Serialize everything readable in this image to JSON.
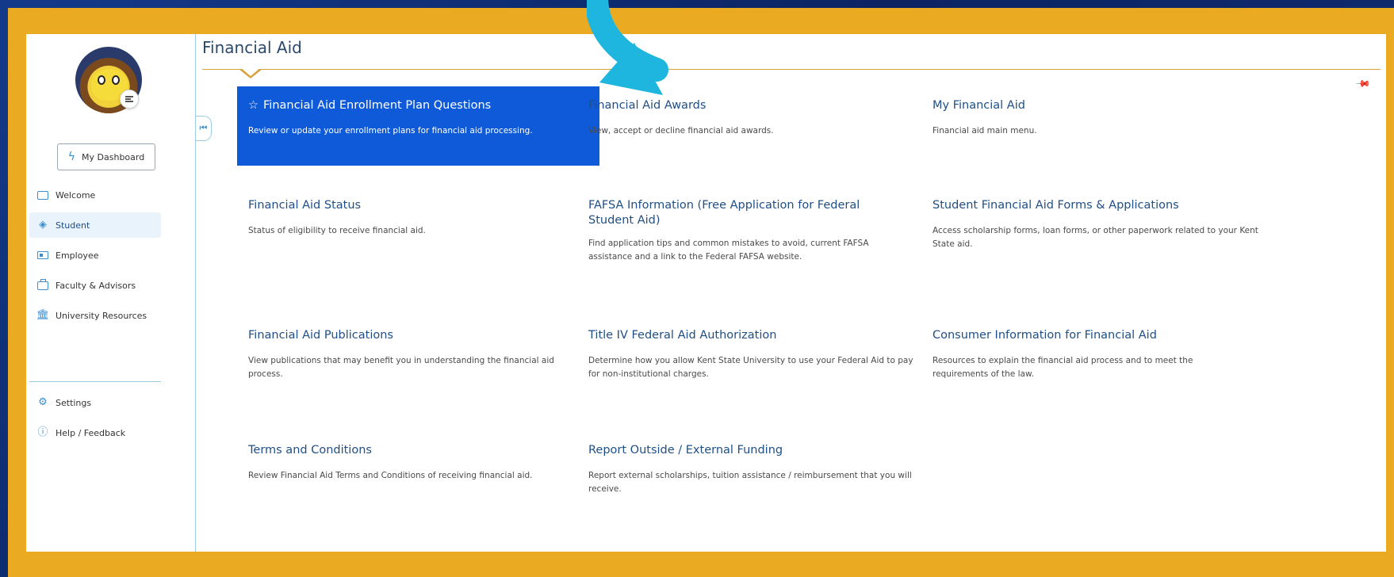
{
  "page_title": "Financial Aid",
  "sidebar": {
    "dashboard_label": "My Dashboard",
    "items": [
      {
        "label": "Welcome"
      },
      {
        "label": "Student"
      },
      {
        "label": "Employee"
      },
      {
        "label": "Faculty & Advisors"
      },
      {
        "label": "University Resources"
      }
    ],
    "footer_items": [
      {
        "label": "Settings"
      },
      {
        "label": "Help / Feedback"
      }
    ]
  },
  "cards": [
    {
      "title": "Financial Aid Enrollment Plan Questions",
      "desc": "Review or update your enrollment plans for financial aid processing."
    },
    {
      "title": "Financial Aid Awards",
      "desc": "View, accept or decline financial aid awards."
    },
    {
      "title": "My Financial Aid",
      "desc": "Financial aid main menu."
    },
    {
      "title": "Financial Aid Status",
      "desc": "Status of eligibility to receive financial aid."
    },
    {
      "title": "FAFSA Information (Free Application for Federal Student Aid)",
      "desc": "Find application tips and common mistakes to avoid, current FAFSA assistance and a link to the Federal FAFSA website."
    },
    {
      "title": "Student Financial Aid Forms & Applications",
      "desc": "Access scholarship forms, loan forms, or other paperwork related to your Kent State aid."
    },
    {
      "title": "Financial Aid Publications",
      "desc": "View publications that may benefit you in understanding the financial aid process."
    },
    {
      "title": "Title IV Federal Aid Authorization",
      "desc": "Determine how you allow Kent State University to use your Federal Aid to pay for non-institutional charges."
    },
    {
      "title": "Consumer Information for Financial Aid",
      "desc": "Resources to explain the financial aid process and to meet the requirements of the law."
    },
    {
      "title": "Terms and Conditions",
      "desc": "Review Financial Aid Terms and Conditions of receiving financial aid."
    },
    {
      "title": "Report Outside / External Funding",
      "desc": "Report external scholarships, tuition assistance / reimbursement that you will receive."
    }
  ],
  "colors": {
    "frame": "#eaaa22",
    "featured_card": "#0f5ad8",
    "arrow": "#1eb6df",
    "accent": "#3b8fd0"
  }
}
